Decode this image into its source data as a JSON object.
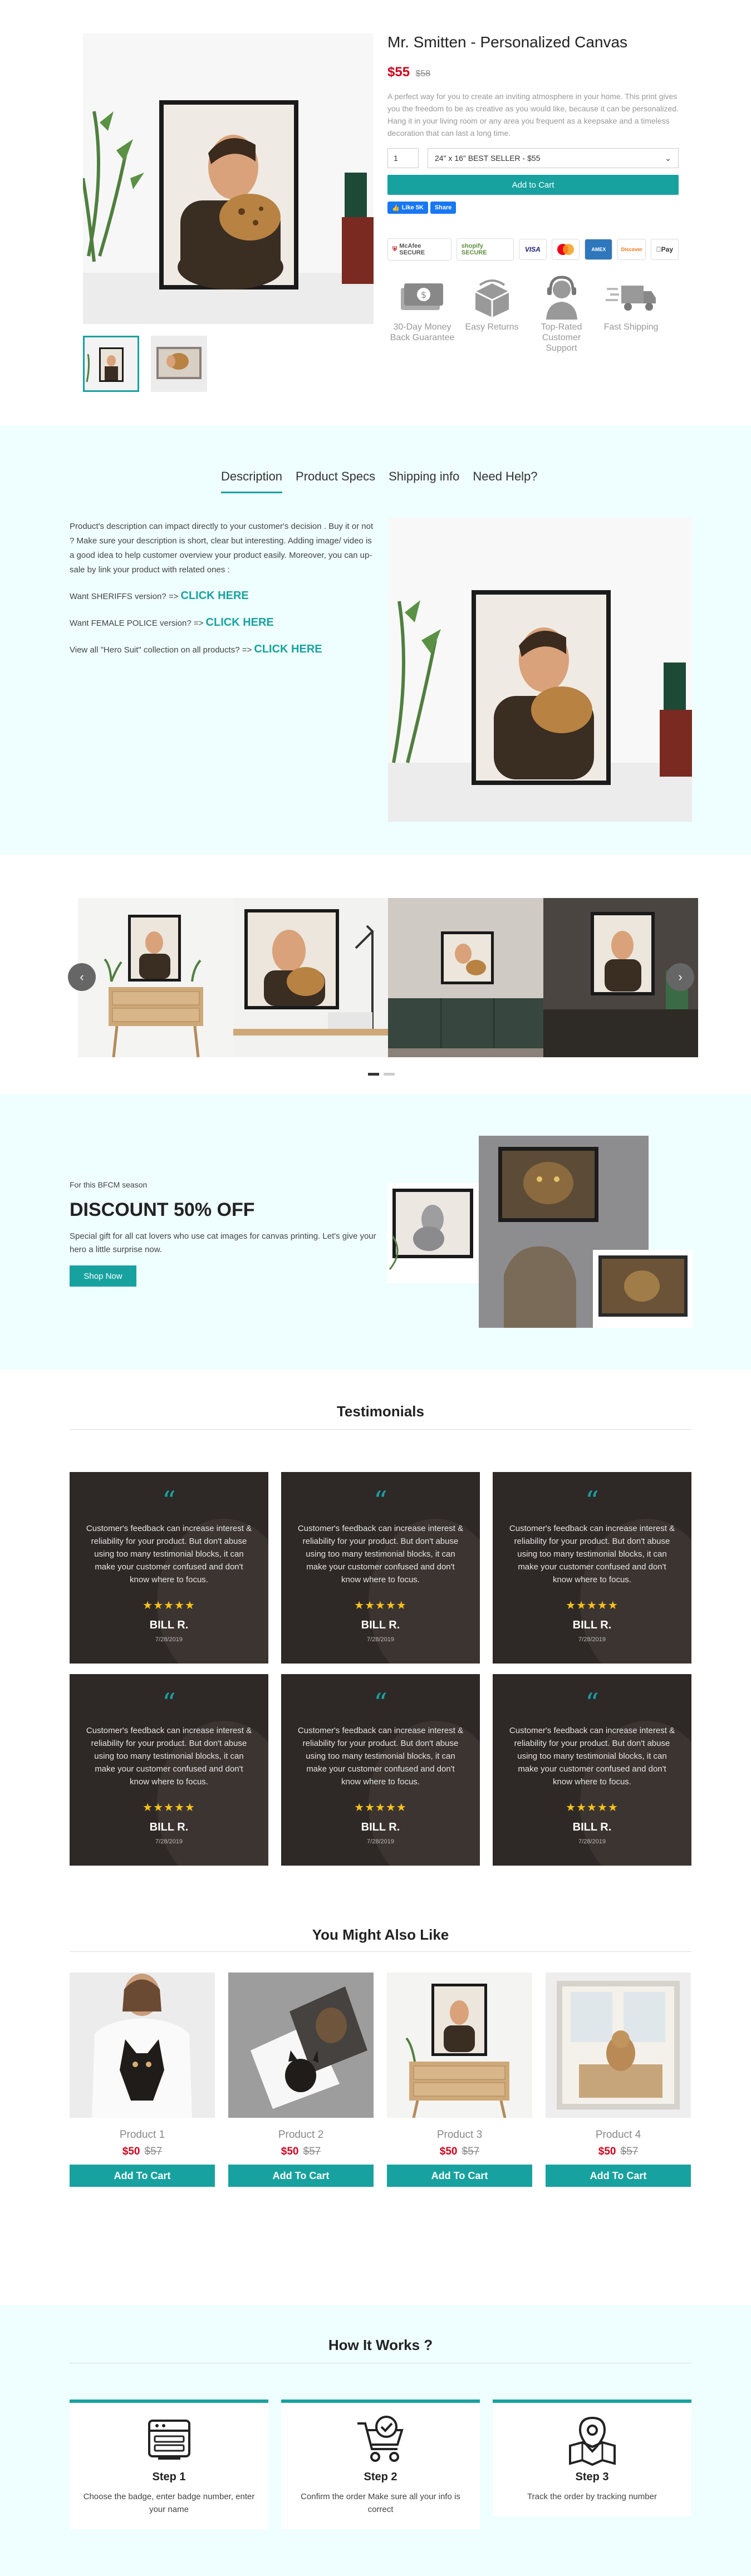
{
  "product": {
    "title": "Mr. Smitten - Personalized Canvas",
    "price": "$55",
    "old_price": "$58",
    "description": "A perfect way for you to create an inviting atmosphere in your home. This print gives you the freedom to be as creative as you would like, because it can be personalized. Hang it in your living room or any area you frequent as a keepsake and a timeless decoration that can last a long time.",
    "quantity": "1",
    "variant": "24\" x 16\" BEST SELLER - $55",
    "add_to_cart": "Add to Cart",
    "fb_like": "Like 5K",
    "fb_share": "Share",
    "trust_badges": [
      "McAfee SECURE",
      "shopify SECURE"
    ],
    "payments": [
      "VISA",
      "Mastercard",
      "AMEX",
      "Discover",
      "Pay"
    ],
    "features": [
      {
        "icon": "money-guarantee-icon",
        "label": "30-Day Money Back Guarantee"
      },
      {
        "icon": "returns-box-icon",
        "label": "Easy Returns"
      },
      {
        "icon": "support-agent-icon",
        "label": "Top-Rated Customer Support"
      },
      {
        "icon": "fast-shipping-icon",
        "label": "Fast Shipping"
      }
    ]
  },
  "tabs": [
    "Description",
    "Product Specs",
    "Shipping info",
    "Need Help?"
  ],
  "description_section": {
    "intro": "Product's description can impact directly to your customer's decision . Buy it or not ? Make sure your description is short, clear but interesting. Adding image/ video is a good idea to help customer overview your product easily. Moreover, you can up-sale by link your product with related ones :",
    "links": [
      {
        "prefix": "Want SHERIFFS version? => ",
        "cta": "CLICK HERE"
      },
      {
        "prefix": "Want FEMALE POLICE version? => ",
        "cta": "CLICK HERE"
      },
      {
        "prefix": "View all \"Hero Suit\" collection on all products? => ",
        "cta": "CLICK HERE"
      }
    ]
  },
  "slider": {
    "prev": "‹",
    "next": "›",
    "dots": 2,
    "active_dot": 0
  },
  "discount": {
    "kicker": "For this BFCM season",
    "title": "DISCOUNT 50% OFF",
    "body": "Special gift for all cat lovers who use cat images for canvas printing. Let's give your hero a little surprise now.",
    "button": "Shop Now"
  },
  "testimonials": {
    "title": "Testimonials",
    "quote_mark": "“",
    "items": [
      {
        "text": "Customer's feedback can increase interest & reliability for your product. But don't abuse using too many testimonial blocks, it can make your customer confused and don't know where to focus.",
        "stars": "★★★★★",
        "name": "BILL R.",
        "date": "7/28/2019"
      },
      {
        "text": "Customer's feedback can increase interest & reliability for your product. But don't abuse using too many testimonial blocks, it can make your customer confused and don't know where to focus.",
        "stars": "★★★★★",
        "name": "BILL R.",
        "date": "7/28/2019"
      },
      {
        "text": "Customer's feedback can increase interest & reliability for your product. But don't abuse using too many testimonial blocks, it can make your customer confused and don't know where to focus.",
        "stars": "★★★★★",
        "name": "BILL R.",
        "date": "7/28/2019"
      },
      {
        "text": "Customer's feedback can increase interest & reliability for your product. But don't abuse using too many testimonial blocks, it can make your customer confused and don't know where to focus.",
        "stars": "★★★★★",
        "name": "BILL R.",
        "date": "7/28/2019"
      },
      {
        "text": "Customer's feedback can increase interest & reliability for your product. But don't abuse using too many testimonial blocks, it can make your customer confused and don't know where to focus.",
        "stars": "★★★★★",
        "name": "BILL R.",
        "date": "7/28/2019"
      },
      {
        "text": "Customer's feedback can increase interest & reliability for your product. But don't abuse using too many testimonial blocks, it can make your customer confused and don't know where to focus.",
        "stars": "★★★★★",
        "name": "BILL R.",
        "date": "7/28/2019"
      }
    ]
  },
  "related": {
    "title": "You Might Also Like",
    "items": [
      {
        "name": "Product 1",
        "price": "$50",
        "old_price": "$57",
        "button": "Add To Cart"
      },
      {
        "name": "Product 2",
        "price": "$50",
        "old_price": "$57",
        "button": "Add To Cart"
      },
      {
        "name": "Product 3",
        "price": "$50",
        "old_price": "$57",
        "button": "Add To Cart"
      },
      {
        "name": "Product 4",
        "price": "$50",
        "old_price": "$57",
        "button": "Add To Cart"
      }
    ]
  },
  "how_it_works": {
    "title": "How It Works ?",
    "steps": [
      {
        "icon": "id-badge-icon",
        "step": "Step 1",
        "text": "Choose the badge, enter badge number, enter your name"
      },
      {
        "icon": "cart-check-icon",
        "step": "Step 2",
        "text": "Confirm the order Make sure all your info is correct"
      },
      {
        "icon": "map-pin-icon",
        "step": "Step 3",
        "text": "Track the order by tracking number"
      }
    ]
  },
  "colors": {
    "accent": "#17a2a0",
    "price_red": "#d0021b",
    "section_bg": "#effefe",
    "testimonial_bg": "#2e2826"
  }
}
